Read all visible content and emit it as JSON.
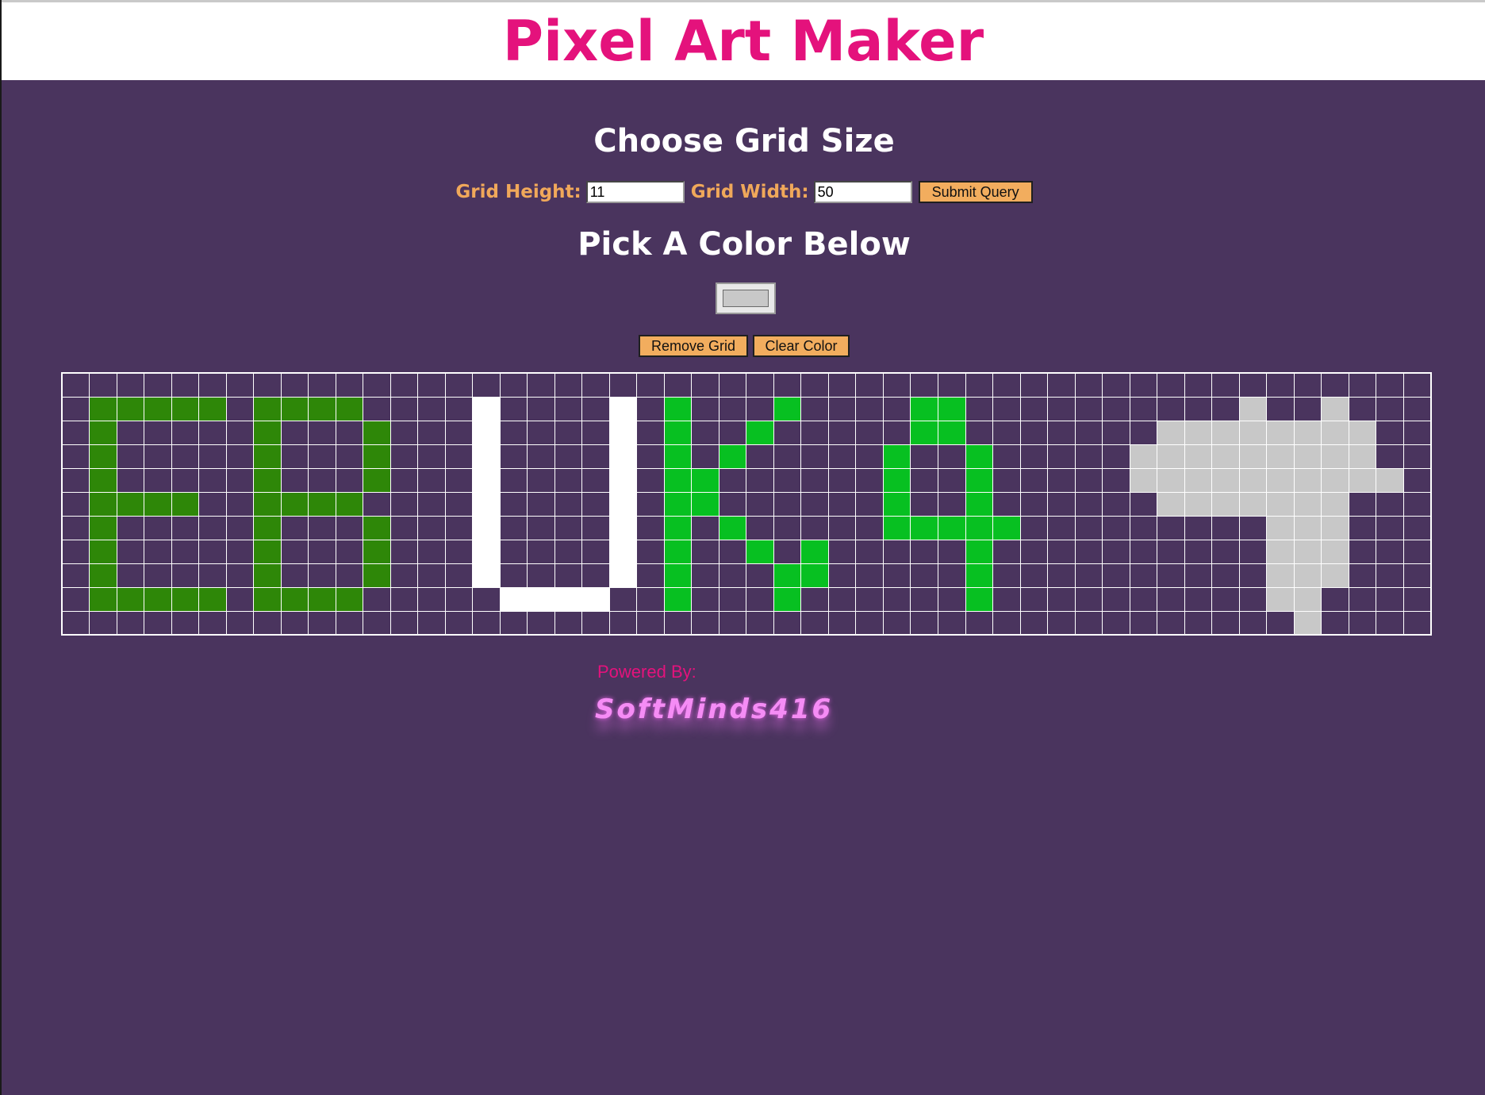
{
  "header": {
    "title": "Pixel Art Maker"
  },
  "grid_size": {
    "heading": "Choose Grid Size",
    "height_label": "Grid Height:",
    "height_value": "11",
    "width_label": "Grid Width:",
    "width_value": "50",
    "submit_label": "Submit Query"
  },
  "color": {
    "heading": "Pick A Color Below",
    "current": "#c8c8c8"
  },
  "actions": {
    "remove_grid_label": "Remove Grid",
    "clear_color_label": "Clear Color"
  },
  "canvas": {
    "rows": 11,
    "cols": 50,
    "palette": {
      "d": "#2e8708",
      "w": "#ffffff",
      "g": "#07c021",
      "s": "#c8c8c8"
    },
    "pixels": [
      "..................................................",
      ".ddddd.dddd....w....w.g...g....gg..........s..s...",
      ".d.....d...d...w....w.g..g.....gg.......ssssssss..",
      ".d.....d...d...w....w.g.g.....g..g.....sssssssss..",
      ".d.....d...d...w....w.gg......g..g.....ssssssssss.",
      ".dddd..dddd....w....w.gg......g..g......sssssss...",
      ".d.....d...d...w....w.g.g.....ggggg.........sss...",
      ".d.....d...d...w....w.g..g.g.....g..........sss...",
      ".d.....d...d...w....w.g...gg.....g..........sss...",
      ".ddddd.dddd.....wwww..g...g......g..........ss....",
      ".............................................s...."
    ]
  },
  "footer": {
    "powered_by": "Powered By:",
    "brand": "SoftMinds416"
  }
}
